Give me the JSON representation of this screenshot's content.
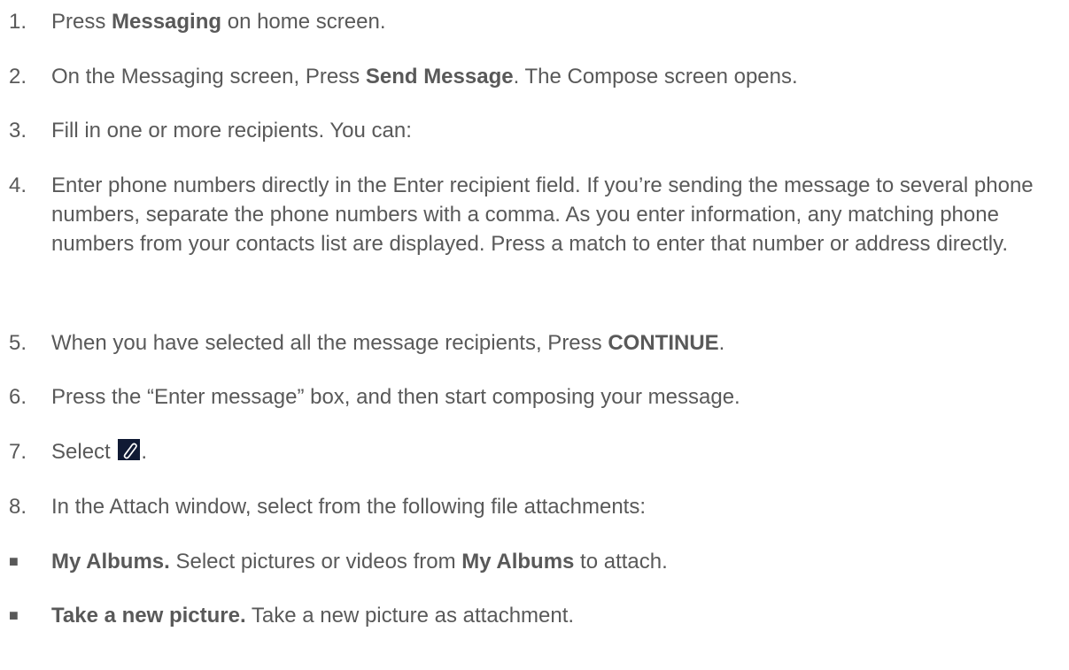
{
  "steps": [
    {
      "num": "1.",
      "pre": "Press ",
      "bold": "Messaging",
      "post": " on home screen."
    },
    {
      "num": "2.",
      "pre": "On the Messaging screen, Press ",
      "bold": "Send Message",
      "post": ". The Compose screen opens."
    },
    {
      "num": "3.",
      "text": "Fill in one or more recipients. You can:"
    },
    {
      "num": "4.",
      "text": "Enter phone numbers directly in the Enter recipient field. If you’re sending the message to several phone numbers, separate the phone numbers with a comma. As you enter information, any matching phone numbers from your contacts list are displayed. Press a match to enter that number or address directly."
    },
    {
      "num": "5.",
      "pre": "When you have selected all the message recipients, Press ",
      "bold": "CONTINUE",
      "post": "."
    },
    {
      "num": "6.",
      "text": "Press the “Enter message” box, and then start composing your message."
    },
    {
      "num": "7.",
      "pre": "Select ",
      "icon": "paperclip-icon",
      "post": "."
    },
    {
      "num": "8.",
      "text": "In the Attach window, select from the following file attachments:"
    }
  ],
  "bullets": [
    {
      "marker": "■",
      "bold": "My Albums.",
      "mid": " Select pictures or videos from ",
      "bold2": "My Albums",
      "post": " to attach."
    },
    {
      "marker": "■",
      "bold": "Take a new picture.",
      "post": " Take a new picture as attachment."
    }
  ]
}
